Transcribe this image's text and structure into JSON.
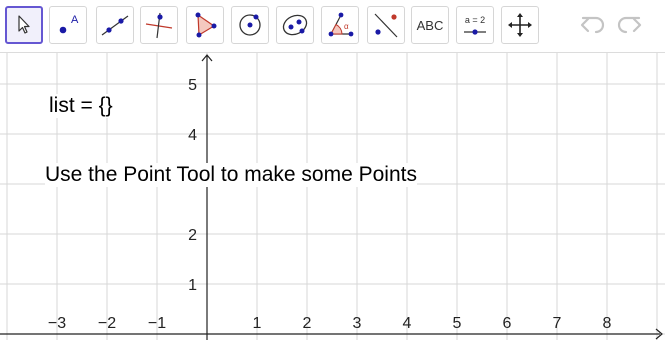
{
  "toolbar": {
    "tools": [
      {
        "name": "move-tool",
        "icon": "arrow-cursor-icon",
        "active": true
      },
      {
        "name": "point-tool",
        "icon": "point-icon",
        "letter": "A"
      },
      {
        "name": "line-tool",
        "icon": "line-through-points-icon"
      },
      {
        "name": "perpendicular-line-tool",
        "icon": "perpendicular-line-icon"
      },
      {
        "name": "polygon-tool",
        "icon": "polygon-icon"
      },
      {
        "name": "circle-center-point-tool",
        "icon": "circle-center-point-icon"
      },
      {
        "name": "ellipse-tool",
        "icon": "ellipse-icon"
      },
      {
        "name": "angle-tool",
        "icon": "angle-icon",
        "letter": "α"
      },
      {
        "name": "reflect-line-tool",
        "icon": "reflect-about-line-icon"
      },
      {
        "name": "text-tool",
        "icon": "text-icon",
        "label": "ABC"
      },
      {
        "name": "slider-tool",
        "icon": "slider-icon",
        "label": "a = 2"
      },
      {
        "name": "move-graphics-view-tool",
        "icon": "move-graphics-icon"
      }
    ],
    "undo_icon": "undo-icon",
    "redo_icon": "redo-icon"
  },
  "texts": {
    "list": "list = {}",
    "instruction": "Use the Point Tool to make some Points"
  },
  "axes": {
    "x_ticks": [
      "−3",
      "−2",
      "−1",
      "1",
      "2",
      "3",
      "4",
      "5",
      "6",
      "7",
      "8"
    ],
    "y_ticks": [
      "1",
      "2",
      "4",
      "5"
    ]
  },
  "colors": {
    "accent": "#6557d2",
    "point": "#1a1aa6",
    "grid": "#d7d7d7",
    "polygon_fill": "#f4c8bf",
    "polygon_stroke": "#c0392b"
  }
}
